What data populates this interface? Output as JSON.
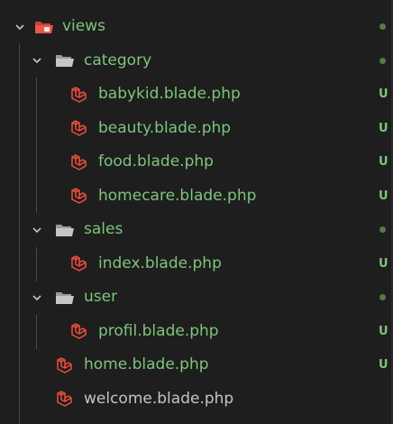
{
  "colors": {
    "background": "#1e1e1e",
    "untracked_text": "#7ec57c",
    "folder_icon": "#c5c5c5",
    "views_folder_icon": "#e8584b",
    "laravel_icon": "#ef4f3a",
    "indent_guide": "#4a4a4a",
    "dot": "#6a9955"
  },
  "tree": {
    "views": {
      "label": "views",
      "icon": "folder-red-open-icon",
      "expanded": true,
      "has_dot": true
    },
    "category": {
      "label": "category",
      "icon": "folder-open-icon",
      "expanded": true,
      "has_dot": true
    },
    "babykid": {
      "label": "babykid.blade.php",
      "icon": "laravel-icon",
      "status": "U"
    },
    "beauty": {
      "label": "beauty.blade.php",
      "icon": "laravel-icon",
      "status": "U"
    },
    "food": {
      "label": "food.blade.php",
      "icon": "laravel-icon",
      "status": "U"
    },
    "homecare": {
      "label": "homecare.blade.php",
      "icon": "laravel-icon",
      "status": "U"
    },
    "sales": {
      "label": "sales",
      "icon": "folder-open-icon",
      "expanded": true,
      "has_dot": true
    },
    "sales_index": {
      "label": "index.blade.php",
      "icon": "laravel-icon",
      "status": "U"
    },
    "user": {
      "label": "user",
      "icon": "folder-open-icon",
      "expanded": true,
      "has_dot": true
    },
    "user_profil": {
      "label": "profil.blade.php",
      "icon": "laravel-icon",
      "status": "U"
    },
    "home": {
      "label": "home.blade.php",
      "icon": "laravel-icon",
      "status": "U"
    },
    "welcome": {
      "label": "welcome.blade.php",
      "icon": "laravel-icon"
    }
  }
}
